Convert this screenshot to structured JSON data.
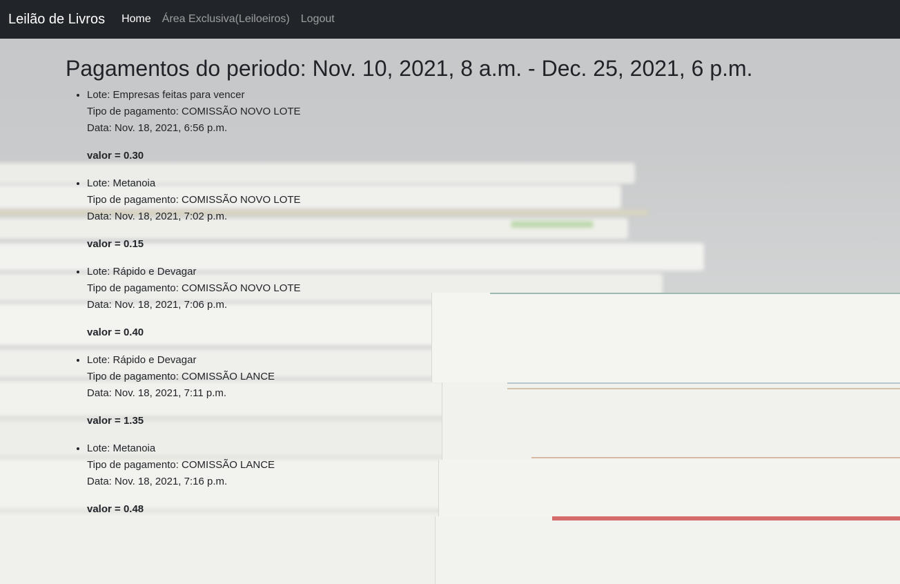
{
  "navbar": {
    "brand": "Leilão de Livros",
    "links": [
      {
        "label": "Home",
        "active": true
      },
      {
        "label": "Área Exclusiva(Leiloeiros)",
        "active": false
      },
      {
        "label": "Logout",
        "active": false
      }
    ]
  },
  "page": {
    "title": "Pagamentos do periodo: Nov. 10, 2021, 8 a.m. - Dec. 25, 2021, 6 p.m."
  },
  "payments": [
    {
      "lote": "Lote: Empresas feitas para vencer",
      "tipo": "Tipo de pagamento: COMISSÃO NOVO LOTE",
      "data": "Data: Nov. 18, 2021, 6:56 p.m.",
      "valor": "valor = 0.30"
    },
    {
      "lote": "Lote: Metanoia",
      "tipo": "Tipo de pagamento: COMISSÃO NOVO LOTE",
      "data": "Data: Nov. 18, 2021, 7:02 p.m.",
      "valor": "valor = 0.15"
    },
    {
      "lote": "Lote: Rápido e Devagar",
      "tipo": "Tipo de pagamento: COMISSÃO NOVO LOTE",
      "data": "Data: Nov. 18, 2021, 7:06 p.m.",
      "valor": "valor = 0.40"
    },
    {
      "lote": "Lote: Rápido e Devagar",
      "tipo": "Tipo de pagamento: COMISSÃO LANCE",
      "data": "Data: Nov. 18, 2021, 7:11 p.m.",
      "valor": "valor = 1.35"
    },
    {
      "lote": "Lote: Metanoia",
      "tipo": "Tipo de pagamento: COMISSÃO LANCE",
      "data": "Data: Nov. 18, 2021, 7:16 p.m.",
      "valor": "valor = 0.48"
    }
  ],
  "colors": {
    "navbar_bg": "#212529",
    "nav_active": "#ffffff",
    "nav_inactive": "rgba(255,255,255,0.55)",
    "text": "#212529"
  }
}
